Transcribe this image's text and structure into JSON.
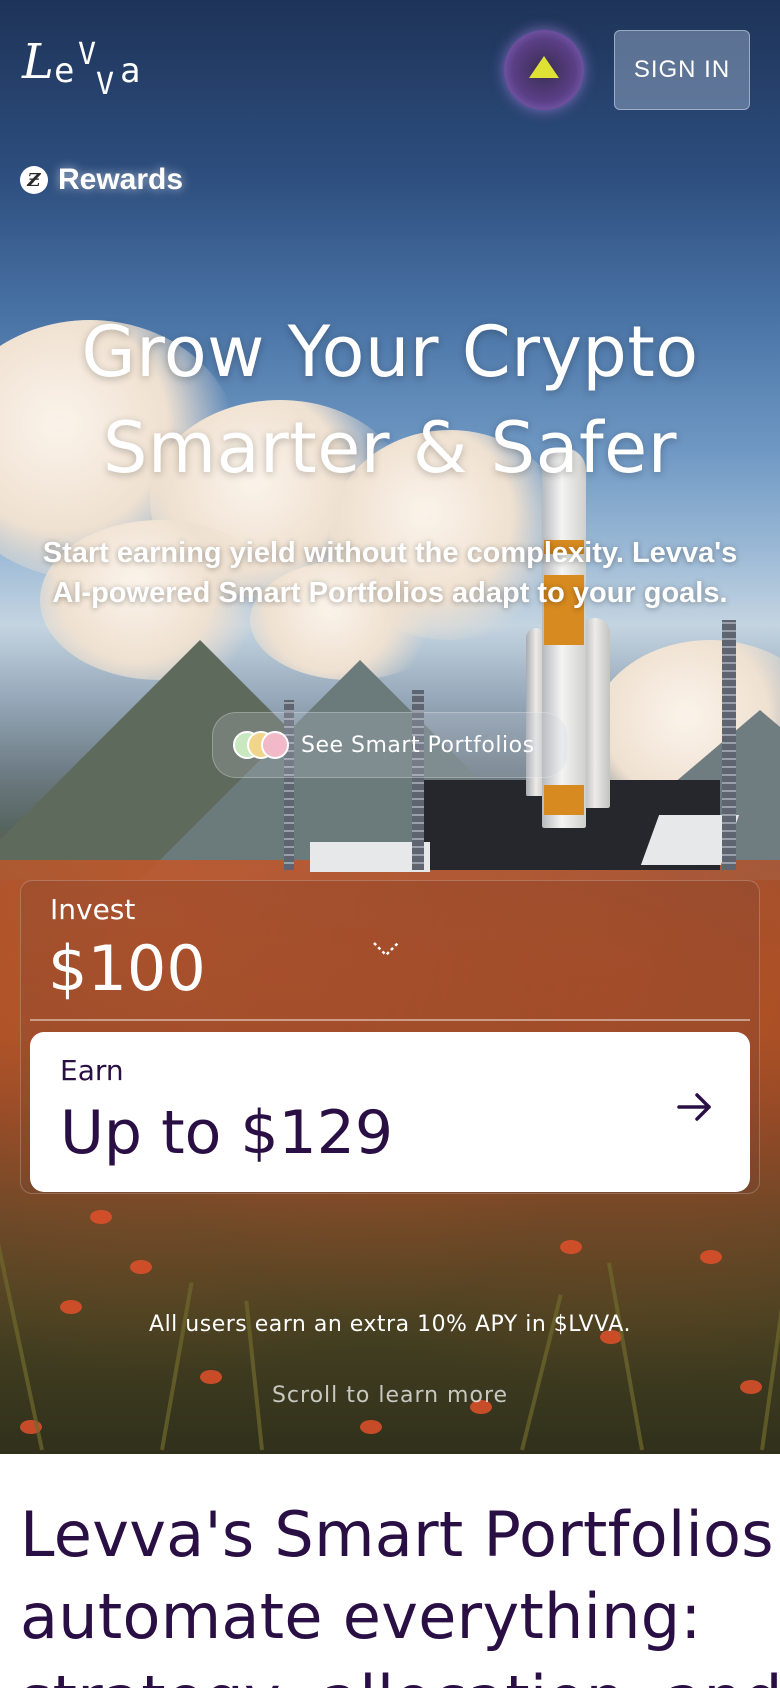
{
  "header": {
    "logo_alt": "Levva",
    "orb_icon": "yellow-triangle-orb-icon",
    "signin_label": "SIGN IN"
  },
  "rewards": {
    "icon_glyph": "Ƶ",
    "label": "Rewards"
  },
  "hero": {
    "headline_line1": "Grow Your Crypto",
    "headline_line2": "Smarter & Safer",
    "subhead": "Start earning yield without the complexity. Levva's AI-powered Smart Portfolios adapt to your goals.",
    "cta_label": "See Smart Portfolios",
    "cta_coin_colors": [
      "#c9e8c0",
      "#f1d58a",
      "#f2b9c8"
    ]
  },
  "calculator": {
    "invest_label": "Invest",
    "invest_value": "$100",
    "dropdown_icon": "chevron-down-icon",
    "earn_label": "Earn",
    "earn_value": "Up to $129",
    "earn_icon": "arrow-right-icon"
  },
  "apy_note": "All users earn an extra 10% APY in $LVVA.",
  "scroll_hint": "Scroll to learn more",
  "section": {
    "title_line1": "Levva's Smart Portfolios",
    "title_line2": "automate everything:",
    "title_line3": "strategy, allocation, and"
  },
  "colors": {
    "brand_dark": "#2a0f45",
    "orb_purple": "#5a3f86",
    "orb_yellow": "#dfe234"
  }
}
